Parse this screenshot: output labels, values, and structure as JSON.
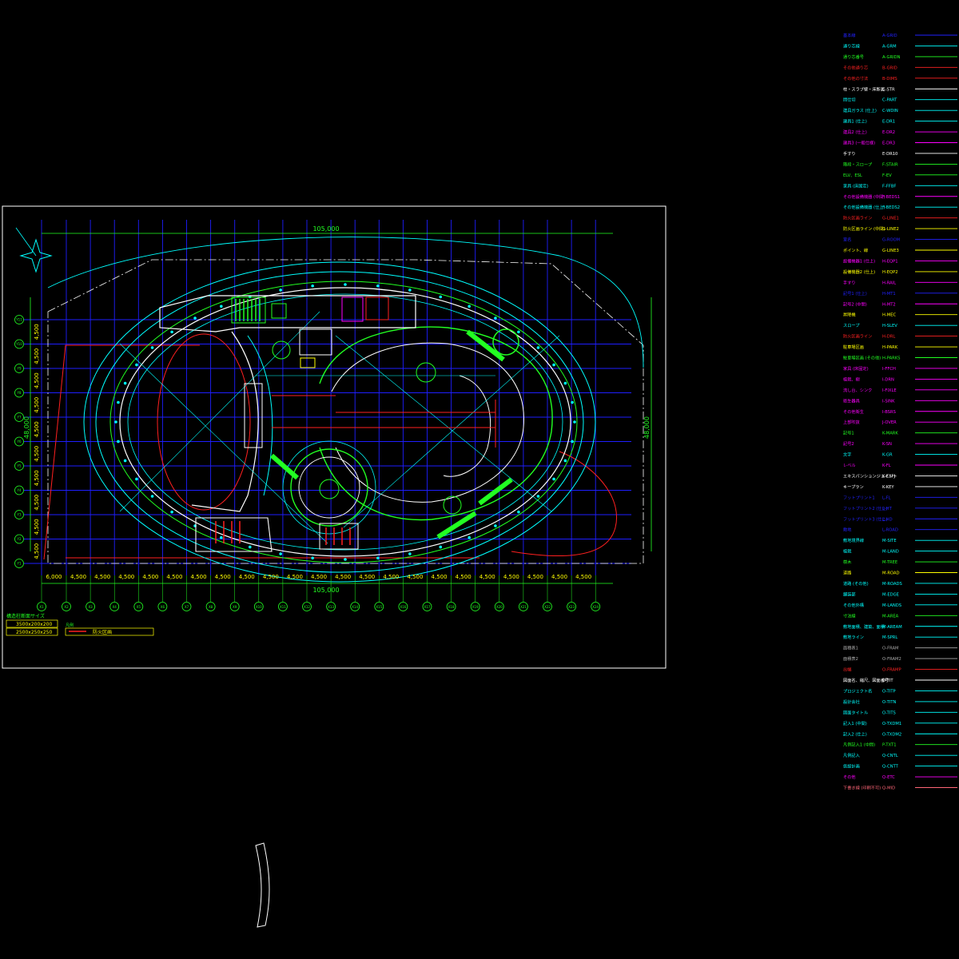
{
  "colors": {
    "background": "#000000",
    "grid": "#1e1eff",
    "dim": "#22ff22",
    "outline": "#00ffff",
    "structure": "#ffffff",
    "accent_red": "#ff2020",
    "accent_yellow": "#ffff00",
    "accent_green": "#22dd22",
    "accent_magenta": "#ff00ff"
  },
  "drawing": {
    "dimensions": {
      "top_total": "105,000",
      "bottom_total": "105,000",
      "left_total": "48,000",
      "right_total": "48,000",
      "bottom_spans": [
        "6,000",
        "4,500",
        "4,500",
        "4,500",
        "4,500",
        "4,500",
        "4,500",
        "4,500",
        "4,500",
        "4,500",
        "4,500",
        "4,500",
        "4,500",
        "4,500",
        "4,500",
        "4,500",
        "4,500",
        "4,500",
        "4,500",
        "4,500",
        "4,500",
        "4,500",
        "4,500"
      ],
      "left_spans": [
        "4,500",
        "4,500",
        "4,500",
        "4,500",
        "4,500",
        "4,500",
        "4,500",
        "4,500",
        "4,500",
        "4,500",
        "4,500"
      ]
    },
    "column_tags": [
      "X1",
      "X2",
      "X3",
      "X4",
      "X5",
      "X6",
      "X7",
      "X8",
      "X9",
      "X10",
      "X11",
      "X12",
      "X13",
      "X14",
      "X15",
      "X16",
      "X17",
      "X18",
      "X19",
      "X20",
      "X21",
      "X22",
      "X23",
      "X24"
    ],
    "row_tags": [
      "Y1",
      "Y2",
      "Y3",
      "Y4",
      "Y5",
      "Y6",
      "Y7",
      "Y8",
      "Y9",
      "Y10",
      "Y11"
    ],
    "legend_box": {
      "title": "構造柱断面サイズ",
      "rows": [
        "3500x200x200",
        "2500x250x250"
      ],
      "right_title": "凡例",
      "right_item": "防火区画"
    }
  },
  "layers": [
    {
      "name": "基本線",
      "code": "A-GRID",
      "color": "#2222ff"
    },
    {
      "name": "通り芯線",
      "code": "A-GRM",
      "color": "#00ffff"
    },
    {
      "name": "通り芯番号",
      "code": "A-GRIDN",
      "color": "#22ff22"
    },
    {
      "name": "その他通り芯",
      "code": "B-GRID",
      "color": "#ff2222"
    },
    {
      "name": "その他の寸法",
      "code": "B-DIMS",
      "color": "#ff2222"
    },
    {
      "name": "柱・スラブ壁・床断面",
      "code": "C-STR",
      "color": "#ffffff"
    },
    {
      "name": "間仕切",
      "code": "C-PART",
      "color": "#00ffff"
    },
    {
      "name": "建具ガラス (仕上)",
      "code": "C-WDIN",
      "color": "#00ffff"
    },
    {
      "name": "建具1 (仕上)",
      "code": "E-DR1",
      "color": "#00ffff"
    },
    {
      "name": "建具2 (仕上)",
      "code": "E-DR2",
      "color": "#ff00ff"
    },
    {
      "name": "建具3 (一般仕様)",
      "code": "E-DR3",
      "color": "#ff00ff"
    },
    {
      "name": "手すり",
      "code": "E-DR10",
      "color": "#ffffff"
    },
    {
      "name": "階段・スロープ",
      "code": "F-STAIR",
      "color": "#22ff22"
    },
    {
      "name": "ELV、ESL",
      "code": "F-EV",
      "color": "#22ff22"
    },
    {
      "name": "家具 (床固定)",
      "code": "F-FFBF",
      "color": "#00ffff"
    },
    {
      "name": "その他設備機器 (中間)",
      "code": "F-BEDS1",
      "color": "#ff00ff"
    },
    {
      "name": "その他設備機器 (仕上)",
      "code": "F-BEDS2",
      "color": "#00ffff"
    },
    {
      "name": "防火区画ライン",
      "code": "G-LINE1",
      "color": "#ff2222"
    },
    {
      "name": "防火区画ライン (中間)",
      "code": "G-LINE2",
      "color": "#ffff00"
    },
    {
      "name": "室名",
      "code": "G-ROOM",
      "color": "#2222ff"
    },
    {
      "name": "ポイント、線",
      "code": "G-LINE3",
      "color": "#ffff00"
    },
    {
      "name": "設備機器1 (仕上)",
      "code": "H-EQP1",
      "color": "#ff00ff"
    },
    {
      "name": "設備機器2 (仕上)",
      "code": "H-EQP2",
      "color": "#ffff00"
    },
    {
      "name": "手すり",
      "code": "H-RAIL",
      "color": "#ff00ff"
    },
    {
      "name": "記号1 (仕上)",
      "code": "H-MT1",
      "color": "#2222ff"
    },
    {
      "name": "記号2 (中間)",
      "code": "H-MT2",
      "color": "#ff00ff"
    },
    {
      "name": "昇降機",
      "code": "H-MEC",
      "color": "#ffff00"
    },
    {
      "name": "スロープ",
      "code": "H-SLEV",
      "color": "#00ffff"
    },
    {
      "name": "防火区画ライン",
      "code": "H-DRL",
      "color": "#ff2222"
    },
    {
      "name": "駐車場区画",
      "code": "H-PARK",
      "color": "#ffff00"
    },
    {
      "name": "駐車場区画 (その他)",
      "code": "H-PARKS",
      "color": "#22ff22"
    },
    {
      "name": "家具 (床固定)",
      "code": "I-FFCH",
      "color": "#ff00ff"
    },
    {
      "name": "植栽、樹",
      "code": "I-DRN",
      "color": "#ff00ff"
    },
    {
      "name": "流し台、シンク",
      "code": "I-FIXLE",
      "color": "#ff00ff"
    },
    {
      "name": "衛生器具",
      "code": "I-SINK",
      "color": "#ff00ff"
    },
    {
      "name": "その他衛生",
      "code": "I-BSRS",
      "color": "#ff00ff"
    },
    {
      "name": "上部吹抜",
      "code": "J-OVER",
      "color": "#ff00ff"
    },
    {
      "name": "記号1",
      "code": "K-MARK",
      "color": "#22ff22"
    },
    {
      "name": "記号2",
      "code": "K-SN",
      "color": "#ff00ff"
    },
    {
      "name": "文字",
      "code": "K-GR",
      "color": "#00ffff"
    },
    {
      "name": "レベル",
      "code": "K-FL",
      "color": "#ff00ff"
    },
    {
      "name": "エキスパンションジョイント",
      "code": "K-EXPJ",
      "color": "#ffffff"
    },
    {
      "name": "キープラン",
      "code": "K-KEY",
      "color": "#ffffff"
    },
    {
      "name": "フットプリント1",
      "code": "L-FL",
      "color": "#2222ff"
    },
    {
      "name": "フットプリント2 (仕上)",
      "code": "L-HT",
      "color": "#2222ff"
    },
    {
      "name": "フットプリント3 (仕上)",
      "code": "L-HD",
      "color": "#2222ff"
    },
    {
      "name": "敷地",
      "code": "L-ROAD",
      "color": "#2222ff"
    },
    {
      "name": "敷地境界線",
      "code": "M-SITE",
      "color": "#00ffff"
    },
    {
      "name": "植栽",
      "code": "M-LAND",
      "color": "#00ffff"
    },
    {
      "name": "樹木",
      "code": "M-TREE",
      "color": "#22ff22"
    },
    {
      "name": "道路",
      "code": "M-ROAD",
      "color": "#ffff00"
    },
    {
      "name": "道路 (その他)",
      "code": "M-ROADS",
      "color": "#00ffff"
    },
    {
      "name": "舗装部",
      "code": "M-EDGE",
      "color": "#00ffff"
    },
    {
      "name": "その他外構",
      "code": "M-LANDS",
      "color": "#00ffff"
    },
    {
      "name": "寸法線",
      "code": "M-AREA",
      "color": "#22ff22"
    },
    {
      "name": "敷地面積、建築、面積",
      "code": "M-AREAM",
      "color": "#00ffff"
    },
    {
      "name": "敷地ライン",
      "code": "M-SPRL",
      "color": "#00ffff"
    },
    {
      "name": "面積表1",
      "code": "O-FRAM",
      "color": "#aaaaaa"
    },
    {
      "name": "面積表2",
      "code": "O-FRAM2",
      "color": "#aaaaaa"
    },
    {
      "name": "出幅",
      "code": "O-FRAMP",
      "color": "#ff2222"
    },
    {
      "name": "図面名、縮尺、図面番号",
      "code": "O-TIT",
      "color": "#ffffff"
    },
    {
      "name": "プロジェクト名",
      "code": "O-TITP",
      "color": "#00ffff"
    },
    {
      "name": "設計会社",
      "code": "O-TITN",
      "color": "#00ffff"
    },
    {
      "name": "図面タイトル",
      "code": "O-TITS",
      "color": "#00ffff"
    },
    {
      "name": "記入1 (中間)",
      "code": "O-TXDM1",
      "color": "#00ffff"
    },
    {
      "name": "記入2 (仕上)",
      "code": "O-TXDM2",
      "color": "#00ffff"
    },
    {
      "name": "凡例記入1 (中間)",
      "code": "P-TXT1",
      "color": "#22ff22"
    },
    {
      "name": "凡例記入",
      "code": "Q-CNTL",
      "color": "#00ffff"
    },
    {
      "name": "仮設計画",
      "code": "Q-CNTT",
      "color": "#00ffff"
    },
    {
      "name": "その他",
      "code": "Q-ETC",
      "color": "#ff00ff"
    },
    {
      "name": "下書き線 (印刷不可)",
      "code": "Q-MID",
      "color": "#ff6677"
    }
  ]
}
